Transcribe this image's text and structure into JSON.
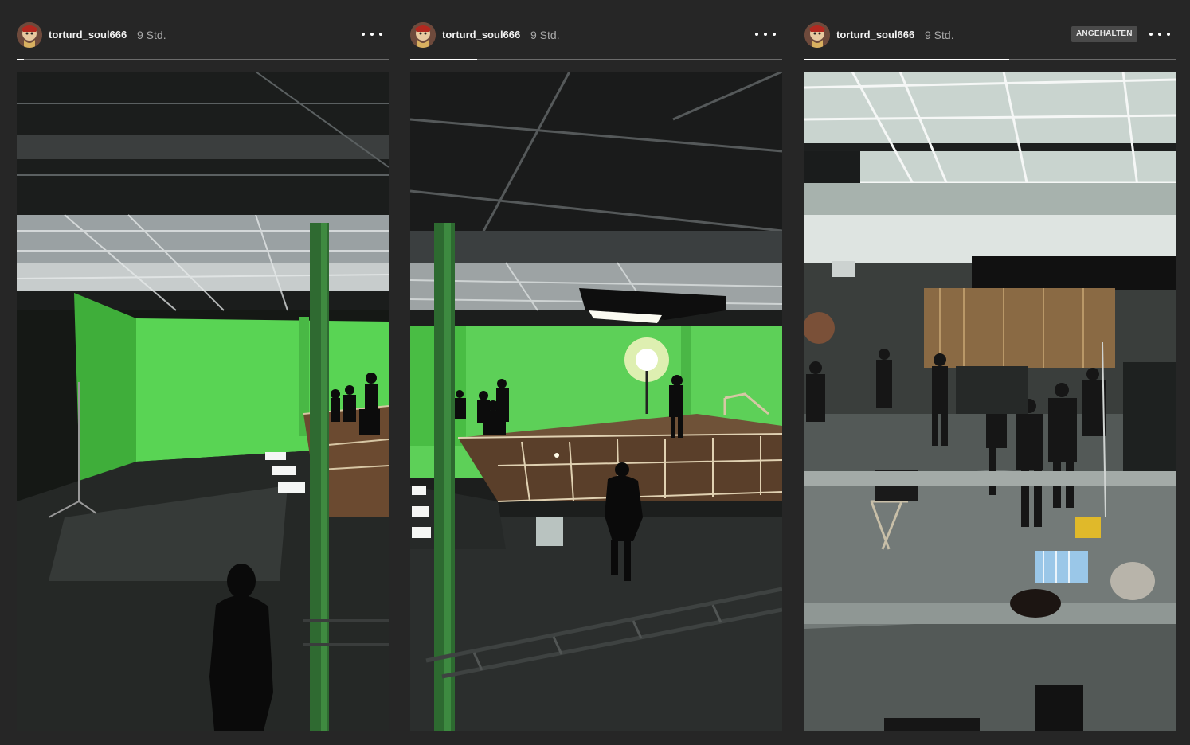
{
  "stories": [
    {
      "username": "torturd_soul666",
      "timestamp": "9 Std.",
      "progress": 0.02,
      "paused_label": null,
      "more_icon": "more-horizontal-icon",
      "media_icon": "video-frame"
    },
    {
      "username": "torturd_soul666",
      "timestamp": "9 Std.",
      "progress": 0.18,
      "paused_label": null,
      "more_icon": "more-horizontal-icon",
      "media_icon": "video-frame"
    },
    {
      "username": "torturd_soul666",
      "timestamp": "9 Std.",
      "progress": 0.55,
      "paused_label": "ANGEHALTEN",
      "more_icon": "more-horizontal-icon",
      "media_icon": "video-frame"
    }
  ],
  "colors": {
    "background": "#262626",
    "green_screen": "#5fd35a",
    "progress_track": "#6b6b6b",
    "progress_fill": "#ffffff"
  }
}
